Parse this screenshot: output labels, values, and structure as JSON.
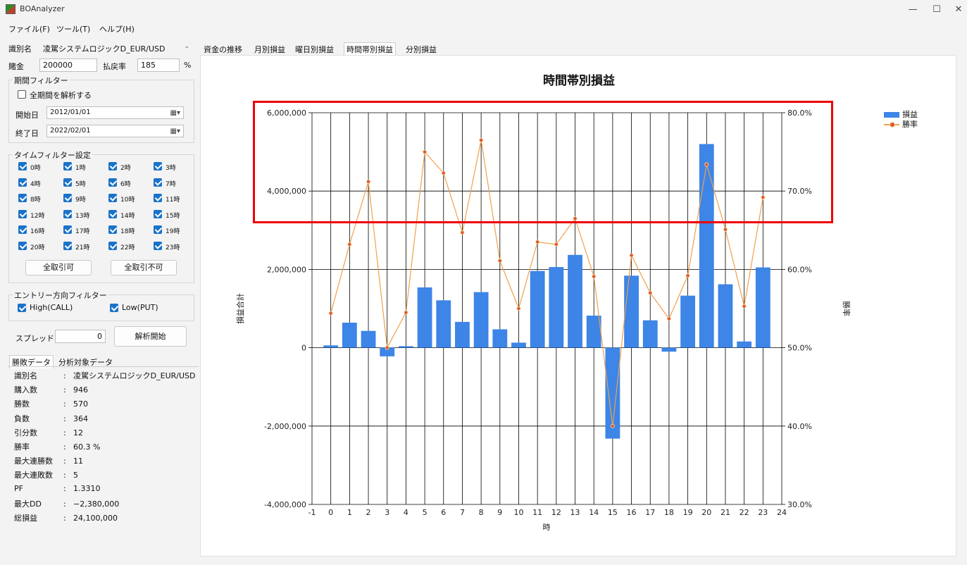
{
  "window": {
    "title": "BOAnalyzer",
    "minimize": "—",
    "maximize": "☐",
    "close": "✕"
  },
  "menu": [
    "ファイル(F)",
    "ツール(T)",
    "ヘルプ(H)"
  ],
  "left_panel": {
    "id_label": "識別名",
    "id_value": "凌駕システムロジックD_EUR/USD",
    "stake_label": "賭金",
    "stake_value": "200000",
    "payout_label": "払戻率",
    "payout_value": "185",
    "payout_unit": "%",
    "period_filter": {
      "title": "期間フィルター",
      "all_label": "全期間を解析する",
      "start_label": "開始日",
      "start_value": "2012/01/01",
      "end_label": "終了日",
      "end_value": "2022/02/01"
    },
    "time_filter": {
      "title": "タイムフィルター設定",
      "hours": [
        "0時",
        "1時",
        "2時",
        "3時",
        "4時",
        "5時",
        "6時",
        "7時",
        "8時",
        "9時",
        "10時",
        "11時",
        "12時",
        "13時",
        "14時",
        "15時",
        "16時",
        "17時",
        "18時",
        "19時",
        "20時",
        "21時",
        "22時",
        "23時"
      ],
      "all_on": "全取引可",
      "all_off": "全取引不可"
    },
    "entry_filter": {
      "title": "エントリー方向フィルター",
      "high": "High(CALL)",
      "low": "Low(PUT)"
    },
    "spread_label": "スプレッド",
    "spread_value": "0",
    "analyze_button": "解析開始",
    "tabs": [
      "勝敗データ",
      "分析対象データ"
    ],
    "stats": [
      {
        "k": "識別名",
        "v": "凌駕システムロジックD_EUR/USD"
      },
      {
        "k": "購入数",
        "v": "946"
      },
      {
        "k": "勝数",
        "v": "570"
      },
      {
        "k": "負数",
        "v": "364"
      },
      {
        "k": "引分数",
        "v": "12"
      },
      {
        "k": "勝率",
        "v": "60.3 %"
      },
      {
        "k": "最大連勝数",
        "v": "11"
      },
      {
        "k": "最大連敗数",
        "v": "5"
      },
      {
        "k": "PF",
        "v": "1.3310"
      },
      {
        "k": "最大DD",
        "v": "−2,380,000"
      },
      {
        "k": "総損益",
        "v": "24,100,000"
      }
    ]
  },
  "chart_tabs": [
    "資金の推移",
    "月別損益",
    "曜日別損益",
    "時間帯別損益",
    "分別損益"
  ],
  "chart_data": {
    "type": "bar",
    "title": "時間帯別損益",
    "xlabel": "時",
    "ylabel": "損益合計",
    "y2label": "勝率",
    "x": [
      0,
      1,
      2,
      3,
      4,
      5,
      6,
      7,
      8,
      9,
      10,
      11,
      12,
      13,
      14,
      15,
      16,
      17,
      18,
      19,
      20,
      21,
      22,
      23
    ],
    "xlim": [
      -1,
      24
    ],
    "ylim": [
      -4000000,
      6000000
    ],
    "y2lim": [
      30,
      80
    ],
    "yticks": [
      "6,000,000",
      "4,000,000",
      "2,000,000",
      "0",
      "-2,000,000",
      "-4,000,000"
    ],
    "y2ticks": [
      "80.0%",
      "70.0%",
      "60.0%",
      "50.0%",
      "40.0%",
      "30.0%"
    ],
    "series": [
      {
        "name": "損益",
        "type": "bar",
        "color": "#3d85e6",
        "values": [
          60000,
          640000,
          430000,
          -220000,
          40000,
          1540000,
          1210000,
          660000,
          1420000,
          470000,
          130000,
          1960000,
          2060000,
          2370000,
          820000,
          -2320000,
          1840000,
          700000,
          -100000,
          1330000,
          5200000,
          1620000,
          160000,
          2050000
        ]
      },
      {
        "name": "勝率",
        "type": "line",
        "color": "#f0a04a",
        "values": [
          54.4,
          63.2,
          71.2,
          50.0,
          54.5,
          75.0,
          72.3,
          64.7,
          76.5,
          61.1,
          55.0,
          63.5,
          63.2,
          66.5,
          59.1,
          40.0,
          61.8,
          57.0,
          53.7,
          59.2,
          73.4,
          65.1,
          55.3,
          69.2
        ]
      }
    ],
    "legend": "top-right",
    "grid": true
  }
}
